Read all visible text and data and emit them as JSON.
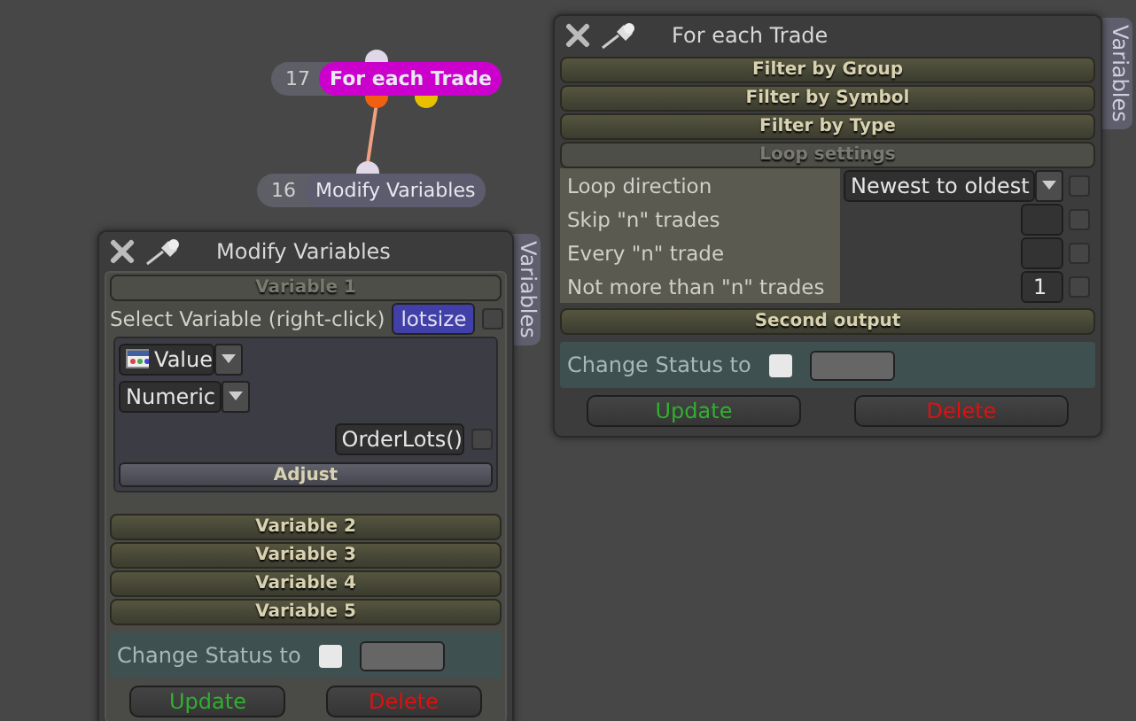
{
  "nodes": [
    {
      "number": "17",
      "title": "For each Trade",
      "color": "#cc00cc"
    },
    {
      "number": "16",
      "title": "Modify Variables",
      "color": "#5c5c6e"
    }
  ],
  "modify_panel": {
    "title": "Modify Variables",
    "side_tab": "Variables",
    "variable_1": {
      "header": "Variable 1",
      "select_label": "Select Variable (right-click)",
      "variable_name": "lotsize",
      "name_checked": false,
      "type_value": "Value",
      "format_value": "Numeric",
      "function_value": "OrderLots()",
      "function_checked": false,
      "adjust": "Adjust"
    },
    "sections": [
      "Variable 2",
      "Variable 3",
      "Variable 4",
      "Variable 5"
    ],
    "status_label": "Change Status to",
    "status_checked": false,
    "update": "Update",
    "delete": "Delete"
  },
  "trade_panel": {
    "title": "For each Trade",
    "side_tab": "Variables",
    "sections": [
      "Filter by Group",
      "Filter by Symbol",
      "Filter by Type"
    ],
    "loop_header": "Loop settings",
    "settings": [
      {
        "label": "Loop direction",
        "kind": "dropdown",
        "value": "Newest to oldest",
        "checked": false
      },
      {
        "label": "Skip \"n\" trades",
        "kind": "number",
        "checked": false
      },
      {
        "label": "Every \"n\" trade",
        "kind": "number",
        "checked": false
      },
      {
        "label": "Not more than \"n\" trades",
        "kind": "number",
        "value": "1",
        "checked": false
      }
    ],
    "second_output": "Second output",
    "status_label": "Change Status to",
    "status_checked": false,
    "update": "Update",
    "delete": "Delete"
  }
}
